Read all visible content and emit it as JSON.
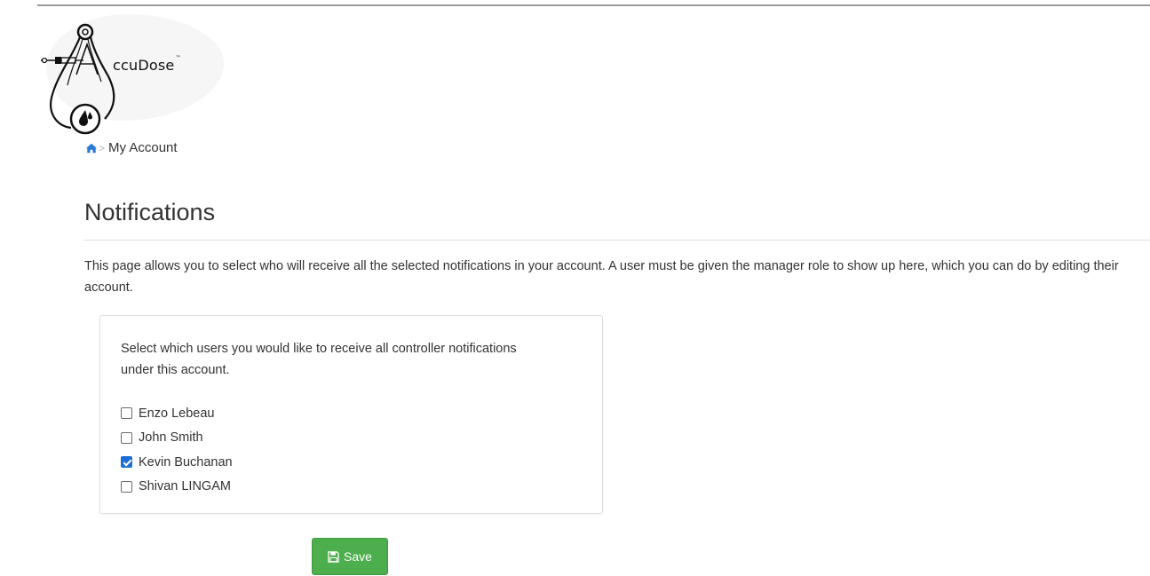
{
  "header": {
    "logo_text": "ccuDose",
    "logo_trademark": "™"
  },
  "breadcrumb": {
    "separator": ">",
    "current": "My Account"
  },
  "main": {
    "title": "Notifications",
    "description": "This page allows you to select who will receive all the selected notifications in your account. A user must be given the manager role to show up here, which you can do by editing their account.",
    "panel": {
      "instruction": "Select which users you would like to receive all controller notifications under this account.",
      "users": [
        {
          "name": "Enzo Lebeau",
          "checked": false
        },
        {
          "name": "John Smith",
          "checked": false
        },
        {
          "name": "Kevin Buchanan",
          "checked": true
        },
        {
          "name": "Shivan LINGAM",
          "checked": false
        }
      ]
    },
    "save_label": "Save"
  },
  "colors": {
    "save_button": "#4cae4c",
    "checkbox_checked": "#1d6ed4",
    "home_icon": "#2a7ad6"
  },
  "icons": {
    "logo": "stethoscope-syringe-drop-icon",
    "home": "home-icon",
    "save": "floppy-disk-icon"
  }
}
